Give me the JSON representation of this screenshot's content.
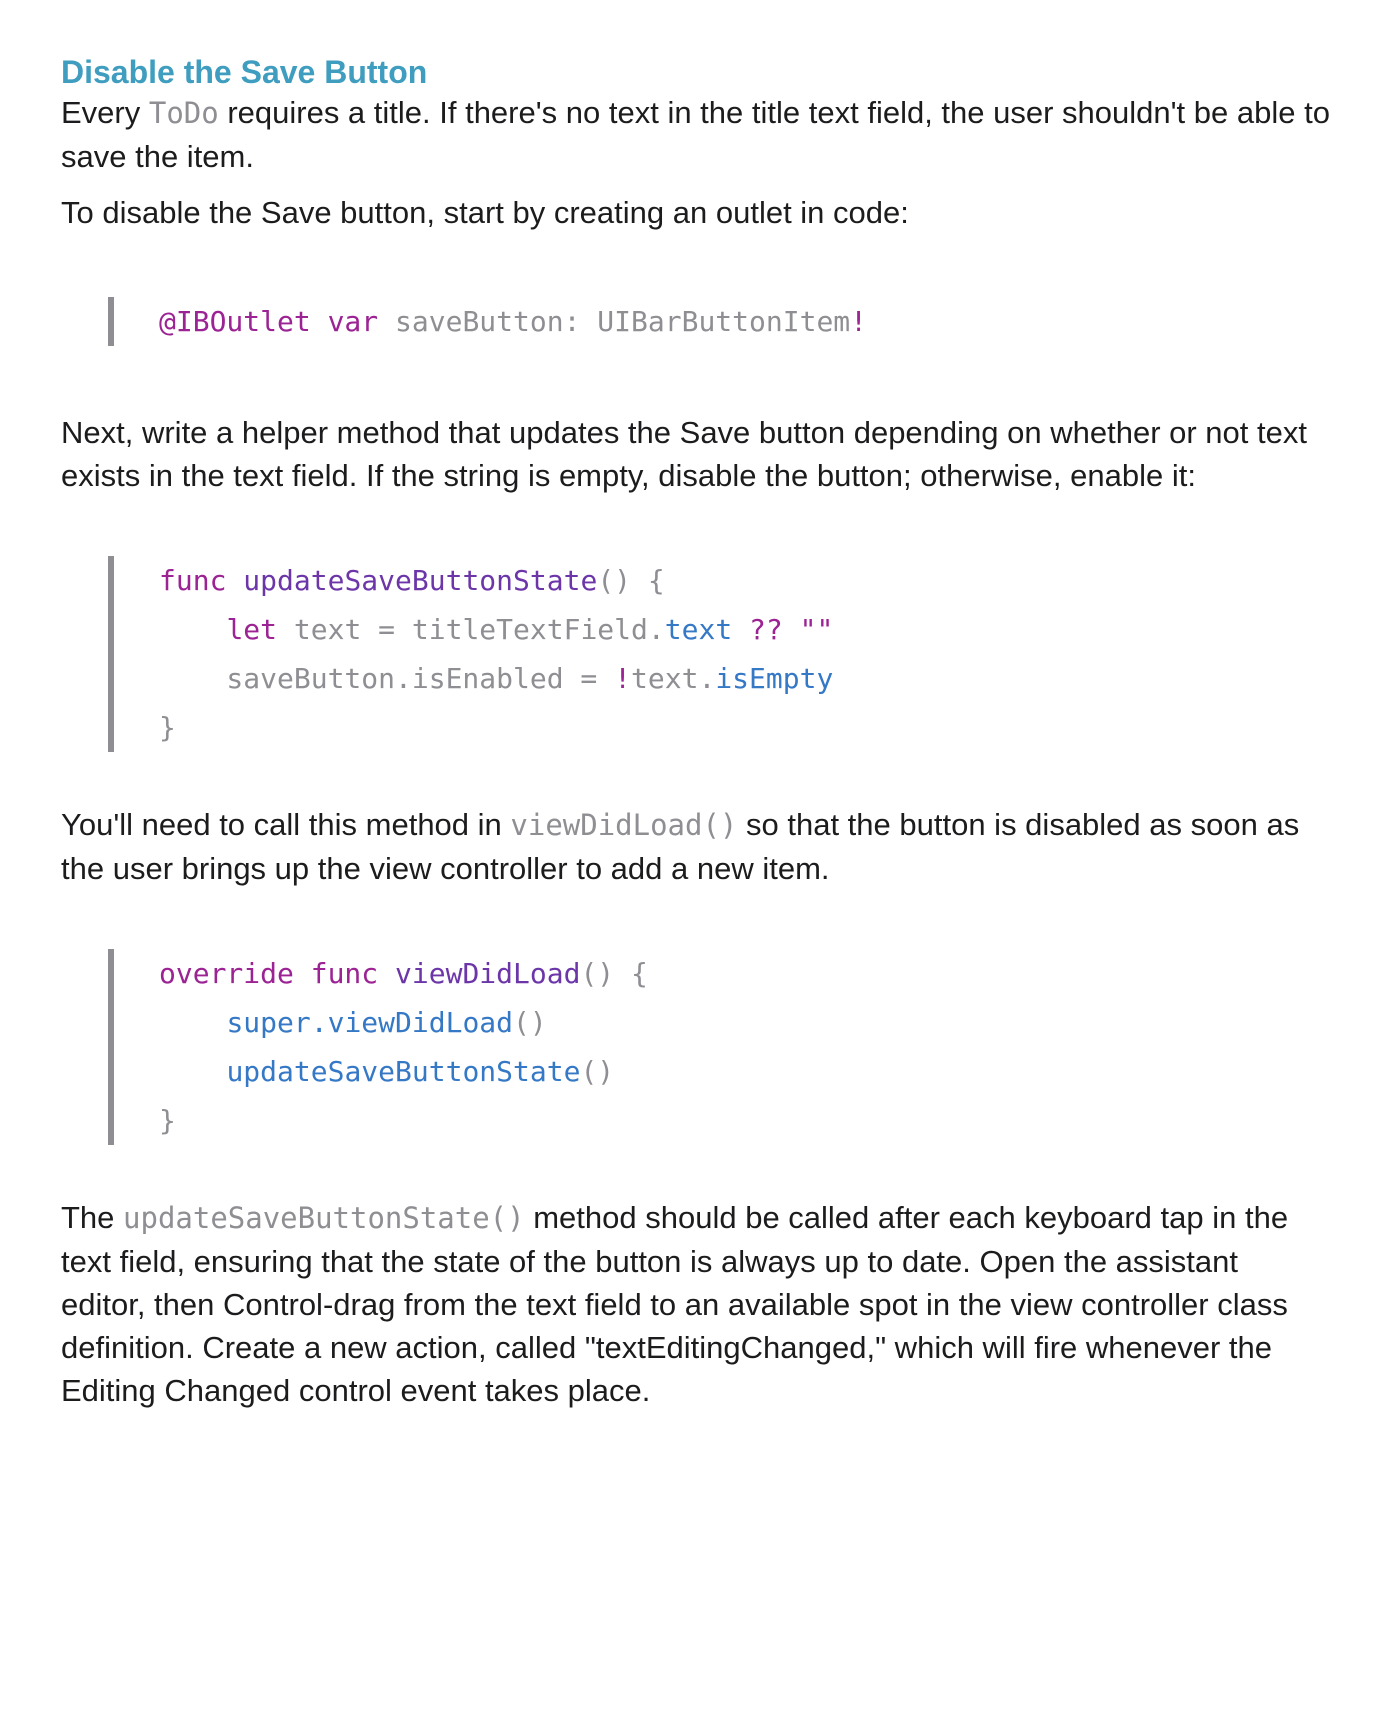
{
  "heading": "Disable the Save Button",
  "para1": {
    "a": "Every ",
    "code": "ToDo",
    "b": " requires a title. If there's no text in the title text field, the user shouldn't be able to save the item."
  },
  "para2": "To disable the Save button, start by creating an outlet in code:",
  "code1": {
    "attr": "@IBOutlet",
    "sp1": " ",
    "kw_var": "var",
    "name": " saveButton: UIBarButtonItem",
    "bang": "!"
  },
  "para3": "Next, write a helper method that updates the Save button depending on whether or not text exists in the text field. If the string is empty, disable the button; otherwise, enable it:",
  "code2": {
    "l1_kw": "func",
    "l1_sp": " ",
    "l1_fn": "updateSaveButtonState",
    "l1_rest": "() {",
    "l2_indent": "    ",
    "l2_kw": "let",
    "l2_a": " text = titleTextField.",
    "l2_mb": "text",
    "l2_b": " ",
    "l2_op": "??",
    "l2_c": " ",
    "l2_str": "\"\"",
    "l3_a": "    saveButton.isEnabled = ",
    "l3_bang": "!",
    "l3_b": "text.",
    "l3_mb": "isEmpty",
    "l4": "}"
  },
  "para4": {
    "a": "You'll need to call this method in ",
    "code": "viewDidLoad()",
    "b": " so that the button is disabled as soon as the user brings up the view controller to add a new item."
  },
  "code3": {
    "l1_kw1": "override",
    "l1_sp1": " ",
    "l1_kw2": "func",
    "l1_sp2": " ",
    "l1_fn": "viewDidLoad",
    "l1_rest": "() {",
    "l2_indent": "    ",
    "l2_mb": "super.viewDidLoad",
    "l2_rest": "()",
    "l3_indent": "    ",
    "l3_mb": "updateSaveButtonState",
    "l3_rest": "()",
    "l4": "}"
  },
  "para5": {
    "a": "The ",
    "code": "updateSaveButtonState()",
    "b": " method should be called after each keyboard tap in the text field, ensuring that the state of the button is always up to date. Open the assistant editor, then Control-drag from the text field to an available spot in the view controller class definition. Create a new action, called \"textEditingChanged,\" which will fire whenever the Editing Changed control event takes place."
  }
}
